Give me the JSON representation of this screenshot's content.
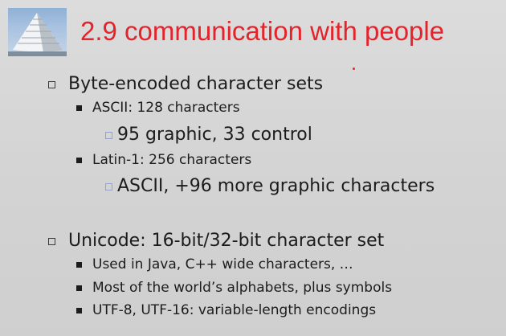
{
  "slide": {
    "title": "2.9  communication with people",
    "items": [
      {
        "text": "Byte-encoded character sets",
        "children": [
          {
            "text": "ASCII: 128 characters",
            "children": [
              {
                "text": "95 graphic, 33 control"
              }
            ]
          },
          {
            "text": "Latin-1: 256 characters",
            "children": [
              {
                "text": "ASCII, +96 more graphic characters"
              }
            ]
          }
        ]
      },
      {
        "text": "Unicode: 16-bit/32-bit character set",
        "children": [
          {
            "text": "Used in Java, C++ wide characters, …"
          },
          {
            "text": "Most of the world’s alphabets, plus symbols"
          },
          {
            "text": "UTF-8, UTF-16: variable-length encodings"
          }
        ]
      }
    ]
  },
  "icons": {
    "logo": "pyramid-logo-icon"
  },
  "colors": {
    "title": "#e3242b",
    "text": "#1c1c1c",
    "background": "#d4d4d4"
  }
}
